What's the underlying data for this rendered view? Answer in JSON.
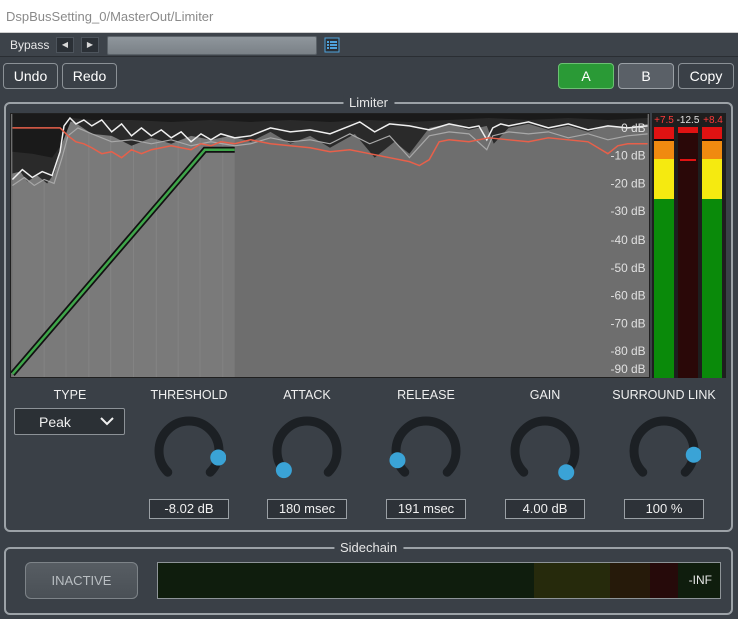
{
  "window": {
    "title": "DspBusSetting_0/MasterOut/Limiter"
  },
  "bypass": {
    "label": "Bypass"
  },
  "toolbar": {
    "undo": "Undo",
    "redo": "Redo",
    "a": "A",
    "b": "B",
    "copy": "Copy"
  },
  "limiter": {
    "title": "Limiter",
    "db_scale": [
      "0 dB",
      "-10 dB",
      "-20 dB",
      "-30 dB",
      "-40 dB",
      "-50 dB",
      "-60 dB",
      "-70 dB",
      "-80 dB",
      "-90 dB"
    ],
    "meters": {
      "peaks": [
        "+7.5",
        "-12.5",
        "+8.4"
      ]
    }
  },
  "controls": {
    "type": {
      "label": "TYPE",
      "value": "Peak"
    },
    "threshold": {
      "label": "THRESHOLD",
      "value": "-8.02 dB",
      "level": 0.88
    },
    "attack": {
      "label": "ATTACK",
      "value": "180 msec",
      "level": 0.02
    },
    "release": {
      "label": "RELEASE",
      "value": "191 msec",
      "level": 0.1
    },
    "gain": {
      "label": "GAIN",
      "value": "4.00 dB",
      "level": 1.0
    },
    "surround_link": {
      "label": "SURROUND LINK",
      "value": "100 %",
      "level": 0.86
    }
  },
  "sidechain": {
    "title": "Sidechain",
    "button": "INACTIVE",
    "readout": "-INF"
  },
  "colors": {
    "accent_green": "#2a9a36",
    "knob_dot": "#3aa3d6",
    "curve_green": "#3fa64a",
    "reduction_red": "#e8604a",
    "meter_red": "#e01212",
    "meter_orange": "#f08a10",
    "meter_yellow": "#f5ea10",
    "meter_green": "#0a8a0a"
  }
}
